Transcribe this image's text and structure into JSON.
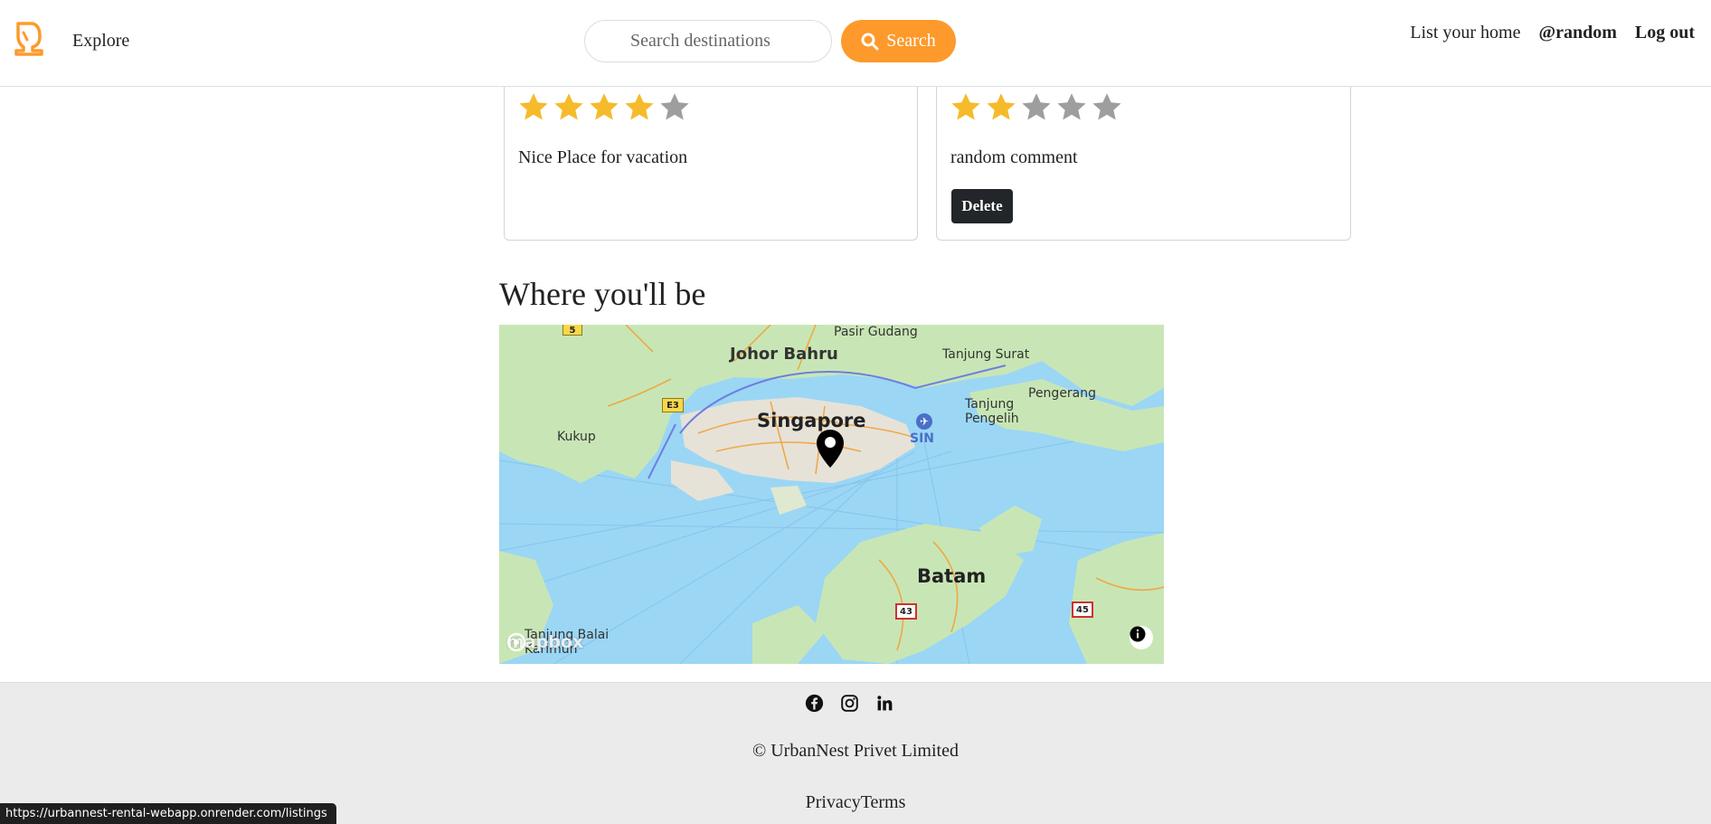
{
  "navbar": {
    "explore_label": "Explore",
    "search_placeholder": "Search destinations",
    "search_button_label": "Search",
    "list_home_label": "List your home",
    "username": "@random",
    "logout_label": "Log out",
    "accent_color": "#fd9a2b"
  },
  "reviews": [
    {
      "rating": 4,
      "max_rating": 5,
      "comment": "Nice Place for vacation",
      "deletable": false
    },
    {
      "rating": 2,
      "max_rating": 5,
      "comment": "random comment",
      "deletable": true,
      "delete_label": "Delete"
    }
  ],
  "map_section": {
    "title": "Where you'll be",
    "place_labels": {
      "pasir_gudang": "Pasir Gudang",
      "johor_bahru": "Johor Bahru",
      "tanjung_surat": "Tanjung Surat",
      "pengerang": "Pengerang",
      "tanjung_pengelih": "Tanjung\nPengelih",
      "singapore": "Singapore",
      "sin": "SIN",
      "kukup": "Kukup",
      "batam": "Batam",
      "tanjung_balai": "Tanjung Balai\nKarimun"
    },
    "road_shields": {
      "r5": "5",
      "e3": "E3",
      "r43": "43",
      "r45": "45"
    },
    "attribution": "mapbox"
  },
  "footer": {
    "copyright": "© UrbanNest Privet Limited",
    "links": "PrivacyTerms"
  },
  "status_bar": {
    "url": "https://urbannest-rental-webapp.onrender.com/listings"
  }
}
